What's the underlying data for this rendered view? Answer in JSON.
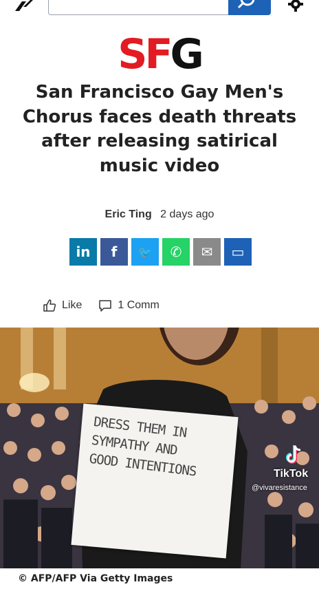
{
  "header": {
    "search_placeholder": "",
    "search_value": ""
  },
  "brand": {
    "sf": "SF",
    "g": "G",
    "colors": {
      "sf": "#e31b23",
      "g": "#111111"
    }
  },
  "article": {
    "headline": "San Francisco Gay Men's Chorus faces death threats after releasing satirical music video",
    "author": "Eric Ting",
    "time": "2 days ago"
  },
  "share": [
    {
      "name": "linkedin",
      "glyph": "in",
      "color": "#0a7aa8"
    },
    {
      "name": "facebook",
      "glyph": "f",
      "color": "#3b5998"
    },
    {
      "name": "twitter",
      "glyph": "🐦",
      "color": "#1da1f2"
    },
    {
      "name": "whatsapp",
      "glyph": "✆",
      "color": "#25d366"
    },
    {
      "name": "email",
      "glyph": "✉",
      "color": "#8a8a8a"
    },
    {
      "name": "comment",
      "glyph": "▭",
      "color": "#1d62b6"
    }
  ],
  "reactions": {
    "like": "Like",
    "comment": "1 Comm"
  },
  "photo": {
    "caption": "© AFP/AFP Via Getty Images"
  },
  "overlay": {
    "sign_lines": [
      "DRESS THEM IN",
      "SYMPATHY AND",
      "GOOD INTENTIONS"
    ],
    "tiktok": "TikTok",
    "handle": "@vivaresistance"
  }
}
